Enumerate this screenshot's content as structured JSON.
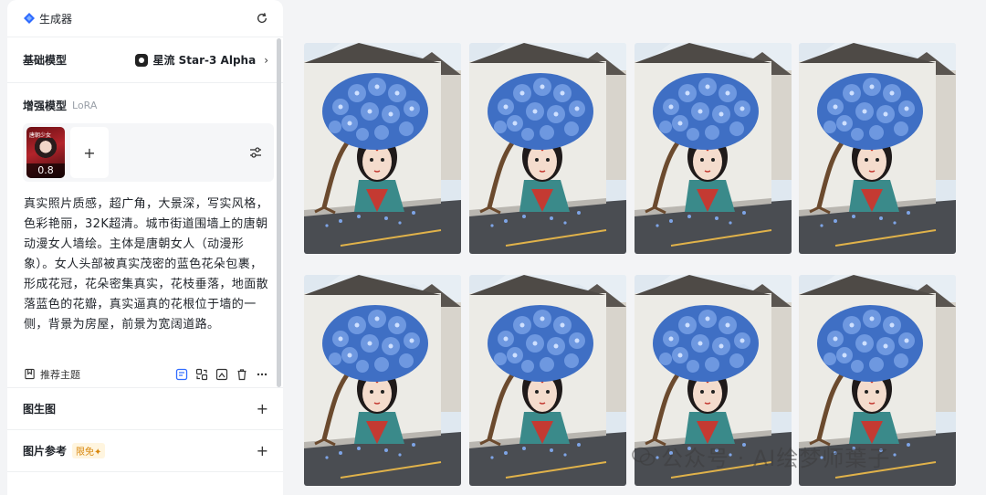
{
  "sidebar": {
    "title": "生成器",
    "base_model_label": "基础模型",
    "base_model_value": "星流 Star-3 Alpha",
    "enhance_label": "增强模型",
    "enhance_sub": "LoRA",
    "lora": {
      "thumb_title": "唐朝少女",
      "weight": "0.8",
      "add": "+"
    },
    "prompt": "真实照片质感，超广角，大景深，写实风格，色彩艳丽，32K超清。城市街道围墙上的唐朝动漫女人墙绘。主体是唐朝女人（动漫形象）。女人头部被真实茂密的蓝色花朵包裹，形成花冠，花朵密集真实，花枝垂落，地面散落蓝色的花瓣，真实逼真的花根位于墙的一侧，背景为房屋，前景为宽阔道路。",
    "recommend_label": "推荐主题",
    "img2img_label": "图生图",
    "img_ref_label": "图片参考",
    "free_badge": "限免",
    "plus": "+"
  },
  "watermark": "公众号 · AI绘梦师葉子",
  "colors": {
    "accent": "#2f6bff",
    "flower": "#5a86d6",
    "wall": "#ecebe6",
    "road": "#4a4d52"
  },
  "gallery": [
    {
      "id": "img-1"
    },
    {
      "id": "img-2"
    },
    {
      "id": "img-3"
    },
    {
      "id": "img-4"
    },
    {
      "id": "img-5"
    },
    {
      "id": "img-6"
    },
    {
      "id": "img-7"
    },
    {
      "id": "img-8"
    }
  ]
}
